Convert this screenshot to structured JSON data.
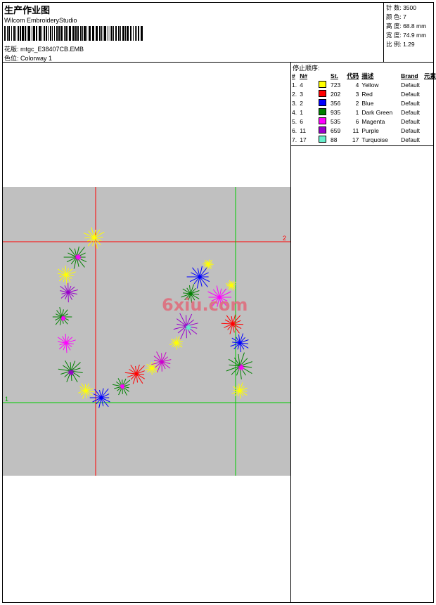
{
  "header": {
    "title": "生产作业图",
    "software": "Wilcom EmbroideryStudio",
    "design_label": "花版:  mtgc_E38407CB.EMB",
    "colorway_label": "色位:  Colorway 1"
  },
  "info": {
    "stitches": "针 数: 3500",
    "colors": "颜 色: 7",
    "height": "高 度: 68.8 mm",
    "width": "宽 度: 74.9 mm",
    "scale": "比 例: 1.29"
  },
  "stop_sequence": {
    "title": "停止顺序:",
    "headers": [
      "#",
      "N#",
      "St.",
      "代码",
      "描述",
      "Brand",
      "元素"
    ],
    "rows": [
      {
        "idx": "1.",
        "n": "4",
        "st": "723",
        "code": "4",
        "desc": "Yellow",
        "brand": "Default",
        "color": "#ffff00"
      },
      {
        "idx": "2.",
        "n": "3",
        "st": "202",
        "code": "3",
        "desc": "Red",
        "brand": "Default",
        "color": "#ff0000"
      },
      {
        "idx": "3.",
        "n": "2",
        "st": "356",
        "code": "2",
        "desc": "Blue",
        "brand": "Default",
        "color": "#0000ff"
      },
      {
        "idx": "4.",
        "n": "1",
        "st": "935",
        "code": "1",
        "desc": "Dark Green",
        "brand": "Default",
        "color": "#008000"
      },
      {
        "idx": "5.",
        "n": "6",
        "st": "535",
        "code": "6",
        "desc": "Magenta",
        "brand": "Default",
        "color": "#ff00ff"
      },
      {
        "idx": "6.",
        "n": "11",
        "st": "659",
        "code": "11",
        "desc": "Purple",
        "brand": "Default",
        "color": "#9900cc"
      },
      {
        "idx": "7.",
        "n": "17",
        "st": "88",
        "code": "17",
        "desc": "Turquoise",
        "brand": "Default",
        "color": "#66eecc"
      }
    ]
  },
  "axis_labels": {
    "marker_2": "2",
    "marker_1": "1"
  },
  "watermark": "6xiu.com"
}
